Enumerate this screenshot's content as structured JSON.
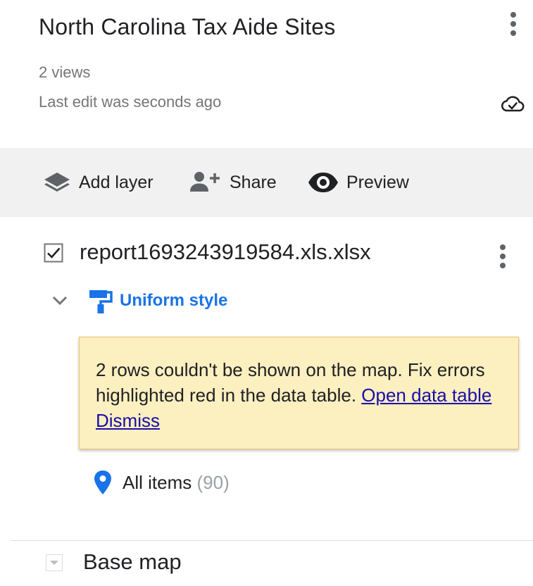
{
  "header": {
    "title": "North Carolina Tax Aide Sites",
    "views": "2 views",
    "last_edit": "Last edit was seconds ago",
    "menu_icon": "more-vert-icon",
    "status_icon": "cloud-done-icon"
  },
  "toolbar": {
    "add_layer": {
      "label": "Add layer",
      "icon": "layers-icon"
    },
    "share": {
      "label": "Share",
      "icon": "person-add-icon"
    },
    "preview": {
      "label": "Preview",
      "icon": "eye-icon"
    }
  },
  "layer": {
    "checked": true,
    "name": "report1693243919584.xls.xlsx",
    "style_label": "Uniform style",
    "style_icon": "paint-roller-icon",
    "menu_icon": "more-vert-icon",
    "warning": {
      "text": "2 rows couldn't be shown on the map. Fix errors highlighted red in the data table. ",
      "open_link": "Open data table",
      "dismiss_link": "Dismiss"
    },
    "items": {
      "label": "All items",
      "count": "(90)",
      "icon": "map-pin-icon"
    }
  },
  "base_map": {
    "label": "Base map",
    "icon": "expand-arrow-icon"
  },
  "colors": {
    "accent": "#1a73e8",
    "link": "#1a0dab",
    "warning_bg": "#fcefc0",
    "toolbar_bg": "#f1f1f1",
    "pin": "#1a73e8"
  }
}
